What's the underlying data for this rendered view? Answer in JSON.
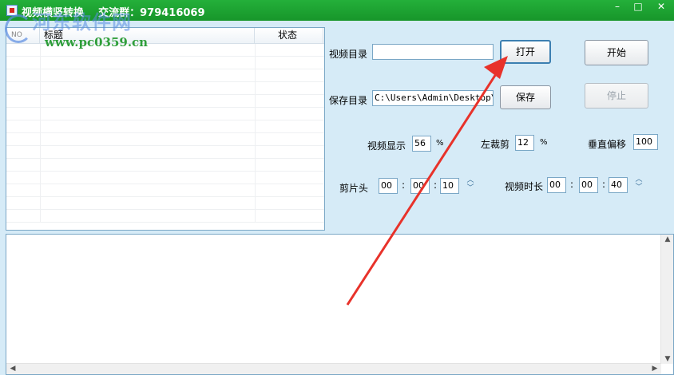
{
  "window": {
    "title": "视频横竖转换    交流群：979416069",
    "min_glyph": "–",
    "max_glyph": "□",
    "close_glyph": "✕"
  },
  "watermark": {
    "text": "河东软件网",
    "url": "www.pc0359.cn"
  },
  "list": {
    "columns": [
      "NO",
      "标题",
      "状态"
    ],
    "rows": []
  },
  "video_dir": {
    "label": "视频目录",
    "value": ""
  },
  "save_dir": {
    "label": "保存目录",
    "value": "C:\\Users\\Admin\\Desktop\\as"
  },
  "buttons": {
    "open": "打开",
    "save": "保存",
    "start": "开始",
    "stop": "停止"
  },
  "settings": {
    "display_label": "视频显示",
    "display_value": "56",
    "display_unit": "%",
    "crop_left_label": "左裁剪",
    "crop_left_value": "12",
    "crop_left_unit": "%",
    "vshift_label": "垂直偏移",
    "vshift_value": "100"
  },
  "clip_head": {
    "label": "剪片头",
    "h": "00",
    "m": "00",
    "s": "10",
    "sep": ":"
  },
  "duration": {
    "label": "视频时长",
    "h": "00",
    "m": "00",
    "s": "40",
    "sep": ":"
  },
  "log": {
    "text": ""
  },
  "colors": {
    "titlebar": "#1d9e2c",
    "client_bg": "#d6ebf7",
    "annotation_arrow": "#e8322a"
  }
}
